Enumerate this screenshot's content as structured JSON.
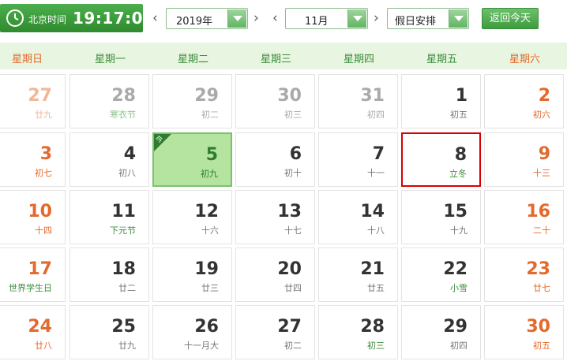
{
  "clock": {
    "label": "北京时间",
    "time": "19:17:04"
  },
  "controls": {
    "year": "2019年",
    "month": "11月",
    "holiday": "假日安排",
    "today_button": "返回今天",
    "prev_arrow": "‹",
    "next_arrow": "›"
  },
  "weekdays": [
    "星期日",
    "星期一",
    "星期二",
    "星期三",
    "星期四",
    "星期五",
    "星期六"
  ],
  "today_mark": "今",
  "days": [
    {
      "d": "27",
      "s": "廿九",
      "other": true,
      "weekend": true
    },
    {
      "d": "28",
      "s": "寒衣节",
      "other": true,
      "festival": true
    },
    {
      "d": "29",
      "s": "初二",
      "other": true
    },
    {
      "d": "30",
      "s": "初三",
      "other": true
    },
    {
      "d": "31",
      "s": "初四",
      "other": true
    },
    {
      "d": "1",
      "s": "初五"
    },
    {
      "d": "2",
      "s": "初六",
      "weekend": true
    },
    {
      "d": "3",
      "s": "初七",
      "weekend": true
    },
    {
      "d": "4",
      "s": "初八"
    },
    {
      "d": "5",
      "s": "初九",
      "today": true
    },
    {
      "d": "6",
      "s": "初十"
    },
    {
      "d": "7",
      "s": "十一"
    },
    {
      "d": "8",
      "s": "立冬",
      "festival": true,
      "selected": true
    },
    {
      "d": "9",
      "s": "十三",
      "weekend": true
    },
    {
      "d": "10",
      "s": "十四",
      "weekend": true
    },
    {
      "d": "11",
      "s": "下元节",
      "festival": true
    },
    {
      "d": "12",
      "s": "十六"
    },
    {
      "d": "13",
      "s": "十七"
    },
    {
      "d": "14",
      "s": "十八"
    },
    {
      "d": "15",
      "s": "十九"
    },
    {
      "d": "16",
      "s": "二十",
      "weekend": true
    },
    {
      "d": "17",
      "s": "世界学生日",
      "weekend": true,
      "festival": true
    },
    {
      "d": "18",
      "s": "廿二"
    },
    {
      "d": "19",
      "s": "廿三"
    },
    {
      "d": "20",
      "s": "廿四"
    },
    {
      "d": "21",
      "s": "廿五"
    },
    {
      "d": "22",
      "s": "小雪",
      "festival": true
    },
    {
      "d": "23",
      "s": "廿七",
      "weekend": true
    },
    {
      "d": "24",
      "s": "廿八",
      "weekend": true
    },
    {
      "d": "25",
      "s": "廿九"
    },
    {
      "d": "26",
      "s": "十一月大"
    },
    {
      "d": "27",
      "s": "初二"
    },
    {
      "d": "28",
      "s": "初三",
      "festival": true
    },
    {
      "d": "29",
      "s": "初四"
    },
    {
      "d": "30",
      "s": "初五",
      "weekend": true
    }
  ],
  "colors": {
    "accent": "#3c8c3c",
    "weekend": "#e36a2c",
    "today_bg": "#b5e3a0",
    "selected_border": "#d90000"
  }
}
